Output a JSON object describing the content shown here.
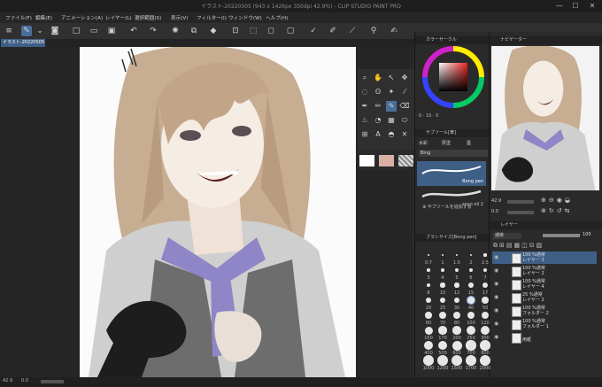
{
  "window": {
    "title": "イラスト-20220505 (943 x 1426px 350dpi 42.9%) - CLIP STUDIO PAINT PRO",
    "close": "✕"
  },
  "menu": [
    "ファイル(F)",
    "編集(E)",
    "アニメーション(A)",
    "レイヤー(L)",
    "選択範囲(S)",
    "表示(V)",
    "フィルター(I)",
    "ウィンドウ(W)",
    "ヘルプ(H)"
  ],
  "tab": {
    "label": "イラスト-20220505 ✕"
  },
  "color_panel": {
    "title": "カラーサークル",
    "hue_hex": "#e22",
    "h": "0",
    "s": "10",
    "v": "0"
  },
  "navigator": {
    "title": "ナビゲーター",
    "zoom": "42.9",
    "rotate": "0.0"
  },
  "subtool": {
    "title": "サブツール[筆]",
    "tabs": [
      "水彩",
      "厚塗",
      "墨"
    ],
    "active": "Bing",
    "brushes": [
      "Bong pen",
      "soyo oil 2"
    ],
    "add": "サブツールを追加する"
  },
  "brush_size": {
    "title": "ブラシサイズ[Bong pen]",
    "sizes": [
      "0.7",
      "1",
      "1.5",
      "2",
      "2.5",
      "3",
      "4",
      "5",
      "6",
      "7",
      "8",
      "10",
      "12",
      "15",
      "17",
      "20",
      "25",
      "30",
      "40",
      "50",
      "60",
      "70",
      "80",
      "100",
      "120",
      "150",
      "170",
      "200",
      "250",
      "300",
      "400",
      "500",
      "600",
      "700",
      "800",
      "1000",
      "1200",
      "1500",
      "1700",
      "2000"
    ]
  },
  "layer_panel": {
    "title": "レイヤー",
    "blend": "通常",
    "opacity": "100",
    "layers": [
      {
        "line1": "100 %通常",
        "line2": "レイヤー 3"
      },
      {
        "line1": "100 %通常",
        "line2": "レイヤー 2"
      },
      {
        "line1": "100 %通常",
        "line2": "レイヤー 4"
      },
      {
        "line1": "25 %通常",
        "line2": "レイヤー 2"
      },
      {
        "line1": "100 %通常",
        "line2": "フォルダー 2"
      },
      {
        "line1": "100 %通常",
        "line2": "フォルダー 1"
      },
      {
        "line1": "",
        "line2": "用紙"
      }
    ]
  },
  "status": {
    "zoom": "42.9",
    "rotate": "0.0"
  }
}
